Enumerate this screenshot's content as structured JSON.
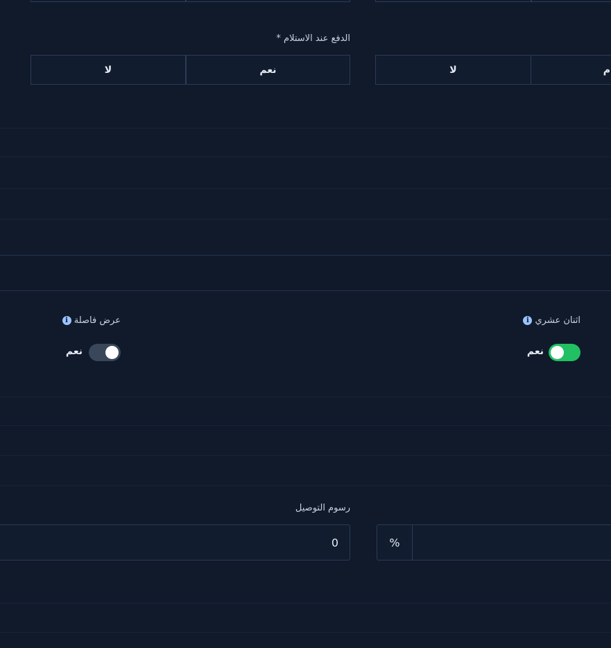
{
  "cod": {
    "label": "الدفع عند الاستلام",
    "required_mark": "*",
    "yes": "نعم",
    "no": "لا"
  },
  "second_group": {
    "no": "لا",
    "yes_partial": "م"
  },
  "decimal": {
    "label": "اثنان عشري",
    "state_text": "نعم",
    "enabled": true
  },
  "comma": {
    "label": "عرض فاصلة",
    "state_text": "نعم",
    "enabled": false
  },
  "delivery_fee": {
    "label": "رسوم التوصيل",
    "value": "0"
  },
  "percent": {
    "symbol": "%"
  },
  "colors": {
    "background": "#101a2b",
    "toggle_on": "#21c063",
    "toggle_off": "#3a4659",
    "info": "#9ac4ff"
  }
}
